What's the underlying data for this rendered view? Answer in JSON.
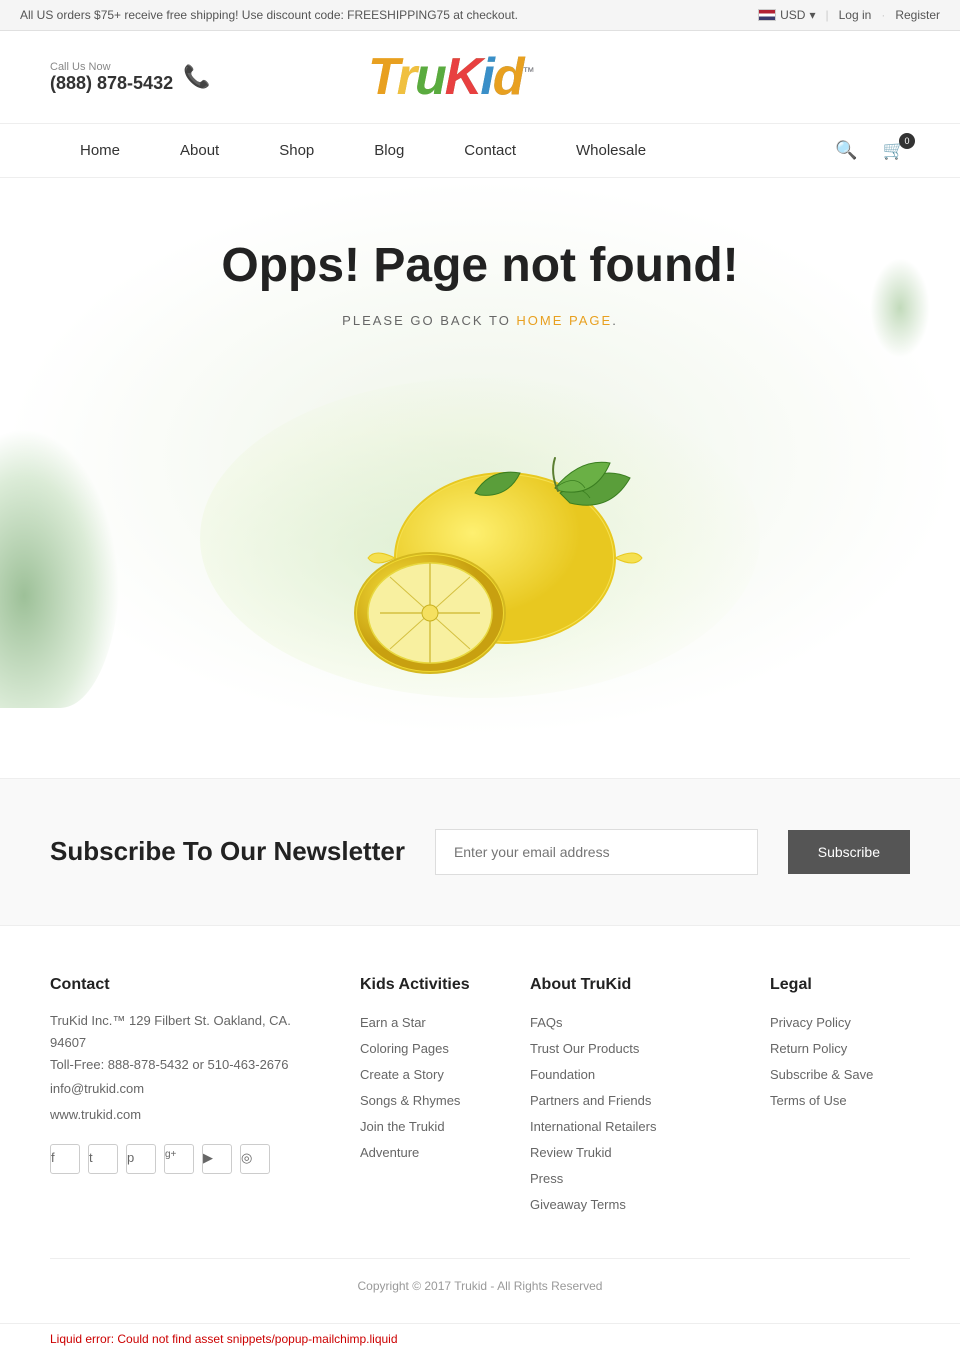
{
  "topbar": {
    "promo_text": "All US orders $75+ receive free shipping! Use discount code: FREESHIPPING75 at checkout.",
    "currency": "USD",
    "login_label": "Log in",
    "register_label": "Register"
  },
  "header": {
    "call_label": "Call Us Now",
    "phone": "(888) 878-5432",
    "logo_text": "TruKid",
    "logo_tm": "™"
  },
  "nav": {
    "links": [
      {
        "label": "Home",
        "href": "#"
      },
      {
        "label": "About",
        "href": "#"
      },
      {
        "label": "Shop",
        "href": "#"
      },
      {
        "label": "Blog",
        "href": "#"
      },
      {
        "label": "Contact",
        "href": "#"
      },
      {
        "label": "Wholesale",
        "href": "#"
      }
    ],
    "cart_count": "0"
  },
  "error_page": {
    "title": "Opps! Page not found!",
    "subtitle": "PLEASE GO BACK TO HOME PAGE.",
    "subtitle_link": "HOME PAGE"
  },
  "newsletter": {
    "title": "Subscribe To Our Newsletter",
    "input_placeholder": "Enter your email address",
    "button_label": "Subscribe"
  },
  "footer": {
    "contact": {
      "heading": "Contact",
      "address": "TruKid Inc.™ 129 Filbert St. Oakland, CA. 94607",
      "tollfree": "Toll-Free: 888-878-5432 or 510-463-2676",
      "email": "info@trukid.com",
      "website": "www.trukid.com"
    },
    "kids_activities": {
      "heading": "Kids Activities",
      "links": [
        {
          "label": "Earn a Star"
        },
        {
          "label": "Coloring Pages"
        },
        {
          "label": "Create a Story"
        },
        {
          "label": "Songs & Rhymes"
        },
        {
          "label": "Join the Trukid"
        },
        {
          "label": "Adventure"
        }
      ]
    },
    "about_trukid": {
      "heading": "About TruKid",
      "links": [
        {
          "label": "FAQs"
        },
        {
          "label": "Trust Our Products"
        },
        {
          "label": "Foundation"
        },
        {
          "label": "Partners and Friends"
        },
        {
          "label": "International Retailers"
        },
        {
          "label": "Review Trukid"
        },
        {
          "label": "Press"
        },
        {
          "label": "Giveaway Terms"
        }
      ]
    },
    "legal": {
      "heading": "Legal",
      "links": [
        {
          "label": "Privacy Policy"
        },
        {
          "label": "Return Policy"
        },
        {
          "label": "Subscribe & Save"
        },
        {
          "label": "Terms of Use"
        }
      ]
    },
    "social_icons": [
      {
        "name": "facebook",
        "symbol": "f"
      },
      {
        "name": "twitter",
        "symbol": "t"
      },
      {
        "name": "pinterest",
        "symbol": "p"
      },
      {
        "name": "google-plus",
        "symbol": "g+"
      },
      {
        "name": "youtube",
        "symbol": "▶"
      },
      {
        "name": "instagram",
        "symbol": "◎"
      }
    ],
    "copyright": "Copyright © 2017 Trukid - All Rights Reserved"
  },
  "liquid_error": {
    "message": "Liquid error: Could not find asset snippets/popup-mailchimp.liquid"
  }
}
